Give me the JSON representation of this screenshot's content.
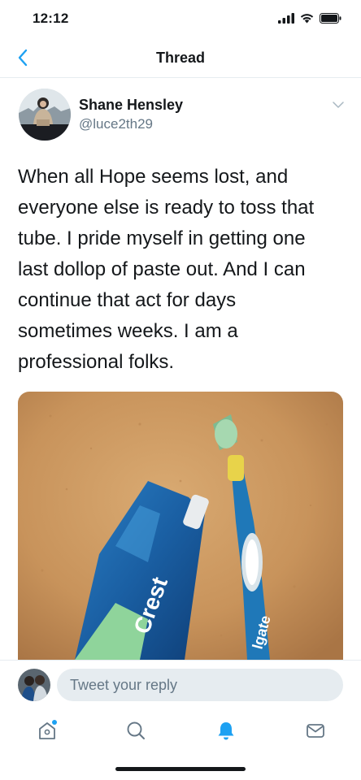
{
  "status_bar": {
    "time": "12:12",
    "icons": [
      "cellular-signal-icon",
      "wifi-icon",
      "battery-icon"
    ]
  },
  "nav": {
    "title": "Thread",
    "back_icon": "chevron-left-icon"
  },
  "tweet": {
    "author_name": "Shane Hensley",
    "author_handle": "@luce2th29",
    "text_lines": [
      "When all Hope seems lost, and",
      "everyone else is ready to toss that",
      "tube. I pride myself in getting one",
      "last dollop of paste out. And I can",
      "continue that act for days",
      "sometimes weeks. I am a",
      "professional folks."
    ],
    "media": {
      "alt_icon": "photo-toothpaste-and-toothbrush",
      "tube_text": "Crest",
      "brush_text": "lgate"
    }
  },
  "reply": {
    "placeholder": "Tweet your reply"
  },
  "tabs": {
    "items": [
      "home-icon",
      "search-icon",
      "notifications-icon",
      "messages-icon"
    ]
  },
  "colors": {
    "accent": "#1da1f2",
    "text": "#14171a",
    "secondary": "#657786",
    "divider": "#e6ecf0"
  }
}
